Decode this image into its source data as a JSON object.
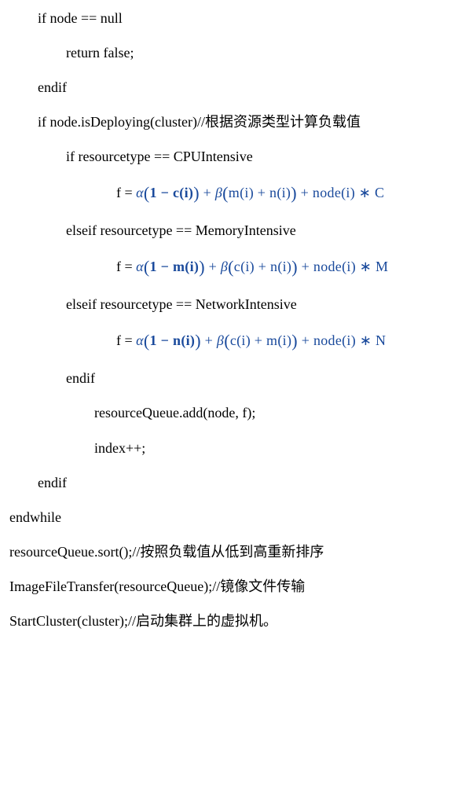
{
  "lines": {
    "l01": "if node == null",
    "l02": "return false;",
    "l03": "endif",
    "l04": "if node.isDeploying(cluster)//根据资源类型计算负载值",
    "l05": "if resourcetype == CPUIntensive",
    "l06_prefix": "f =  ",
    "l07": "elseif resourcetype == MemoryIntensive",
    "l08_prefix": "f =  ",
    "l09": "elseif resourcetype == NetworkIntensive",
    "l10_prefix": "f =  ",
    "l11": "endif",
    "l12": "resourceQueue.add(node, f);",
    "l13": "index++;",
    "l14": "endif",
    "l15": "endwhile",
    "l16": "resourceQueue.sort();//按照负载值从低到高重新排序",
    "l17": "ImageFileTransfer(resourceQueue);//镜像文件传输",
    "l18": "StartCluster(cluster);//启动集群上的虚拟机。"
  },
  "formulas": {
    "f1": {
      "alpha_term_inner": "1 − c(i)",
      "beta_term_inner": "m(i) + n(i)",
      "tail": " + node(i) ∗ C"
    },
    "f2": {
      "alpha_term_inner": "1 − m(i)",
      "beta_term_inner": "c(i) + n(i)",
      "tail": " + node(i) ∗ M"
    },
    "f3": {
      "alpha_term_inner": "1 − n(i)",
      "beta_term_inner": "c(i) + m(i)",
      "tail": " + node(i) ∗ N"
    }
  },
  "symbols": {
    "alpha": "α",
    "beta": "β",
    "plus": " + "
  }
}
